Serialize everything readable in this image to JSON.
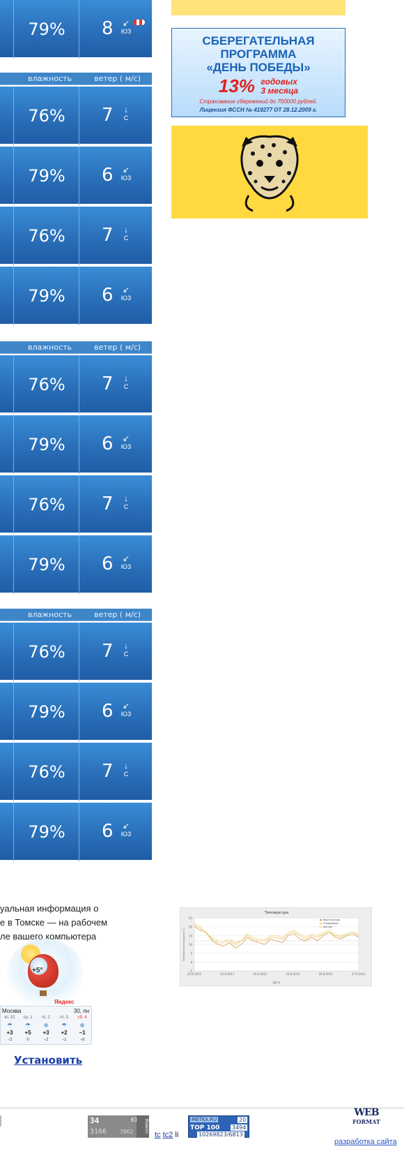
{
  "weather_headers": {
    "humidity": "влажность",
    "wind": "ветер ( м/с)"
  },
  "weather_rows": [
    {
      "humidity": "79%",
      "wind_speed": "8",
      "wind_dir": "ЮЗ",
      "arrow": "↙"
    },
    {
      "humidity": "76%",
      "wind_speed": "7",
      "wind_dir": "С",
      "arrow": "↓"
    },
    {
      "humidity": "79%",
      "wind_speed": "6",
      "wind_dir": "ЮЗ",
      "arrow": "↙"
    },
    {
      "humidity": "76%",
      "wind_speed": "7",
      "wind_dir": "С",
      "arrow": "↓"
    },
    {
      "humidity": "79%",
      "wind_speed": "6",
      "wind_dir": "ЮЗ",
      "arrow": "↙"
    }
  ],
  "banner_savings": {
    "line1": "СБЕРЕГАТЕЛЬНАЯ",
    "line2": "ПРОГРАММА",
    "line3": "«ДЕНЬ ПОБЕДЫ»",
    "percent": "13%",
    "percent_line1": "годовых",
    "percent_line2": "3 месяца",
    "insurance": "Страхование сбережений до 700000 рублей.",
    "license": "Лицензия ФССН № 419277 ОТ 28.12.2009 г."
  },
  "banner_leopard": {
    "icon": "leopard-icon"
  },
  "info": {
    "line1": "уальная информация о",
    "line2": "е в Томске — на рабочем",
    "line3": "ле вашего компьютера"
  },
  "widget": {
    "balloon_temp": "+5°",
    "brand": "Яндекс",
    "city": "Москва",
    "date": "30, пн",
    "days": [
      {
        "day": "вт, 31",
        "temp": "+3",
        "low": "−2",
        "icon": "☂"
      },
      {
        "day": "ср, 1",
        "temp": "+5",
        "low": "0",
        "icon": "☂"
      },
      {
        "day": "чт, 2",
        "temp": "+3",
        "low": "−2",
        "icon": "❄"
      },
      {
        "day": "пт, 3",
        "temp": "+2",
        "low": "−1",
        "icon": "☂"
      },
      {
        "day": "сб, 4",
        "temp": "−1",
        "low": "−6",
        "icon": "❄"
      }
    ],
    "install": "Установить"
  },
  "chart_data": {
    "type": "line",
    "title": "Температура",
    "xlabel": "Дата",
    "ylabel": "Температура воздуха (°C)",
    "legend": [
      "Фактическая",
      "Ожидаемая",
      "Датчик"
    ],
    "legend_position": "top-right",
    "x_ticks": [
      "22.8.2011",
      "23.8.2011",
      "24.8.2011",
      "25.8.2011",
      "26.8.2011",
      "27.8.2011"
    ],
    "y_ticks": [
      25,
      20,
      15,
      10,
      5,
      0,
      -5
    ],
    "series_colors": [
      "#d59a4a",
      "#e8c66a",
      "#f0d890"
    ],
    "series": [
      {
        "values": [
          20,
          18,
          17,
          12,
          10,
          9,
          11,
          8,
          10,
          14,
          12,
          11,
          10,
          13,
          12,
          11,
          15,
          16,
          13,
          12,
          14,
          12,
          15,
          17,
          14,
          13,
          15,
          16,
          14
        ]
      },
      {
        "values": [
          21,
          19,
          17,
          13,
          11,
          11,
          12,
          10,
          12,
          15,
          13,
          12,
          12,
          14,
          14,
          13,
          16,
          17,
          15,
          13,
          15,
          14,
          16,
          17,
          15,
          14,
          16,
          17,
          15
        ]
      },
      {
        "values": [
          22,
          20,
          16,
          14,
          12,
          12,
          13,
          11,
          12,
          16,
          14,
          13,
          13,
          15,
          15,
          14,
          17,
          18,
          16,
          14,
          16,
          15,
          17,
          18,
          16,
          15,
          16,
          17,
          16
        ]
      }
    ],
    "ylim": [
      -5,
      25
    ]
  },
  "counter1": {
    "a": "34",
    "b": "61",
    "c": "3166",
    "d": "7062",
    "side": "Индекс"
  },
  "links": {
    "tc": "tc",
    "tc2": "tc2",
    "li": "li"
  },
  "counter2": {
    "brand": "METKA.RU",
    "b": "20",
    "top": "TOP 100",
    "d": "3494",
    "e": "10269823/6813"
  },
  "webformat": {
    "w1": "WEB",
    "w2": "FORMAT"
  },
  "dev_link": "разработка сайта"
}
